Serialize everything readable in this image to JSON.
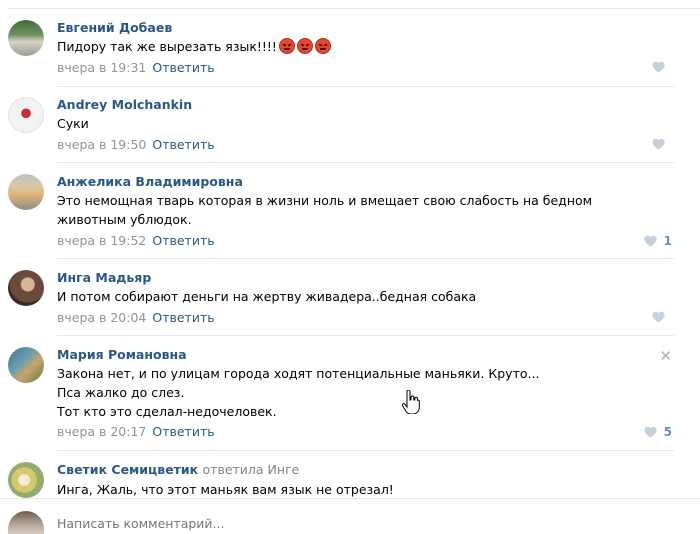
{
  "comments": [
    {
      "author": "Евгений Добаев",
      "text_lines": [
        "Пидору так же вырезать язык!!!!"
      ],
      "emoji_count": 3,
      "time": "вчера в 19:31",
      "reply_label": "Ответить",
      "likes": ""
    },
    {
      "author": "Andrey Molchankin",
      "text_lines": [
        "Суки"
      ],
      "time": "вчера в 19:50",
      "reply_label": "Ответить",
      "likes": ""
    },
    {
      "author": "Анжелика Владимировна",
      "text_lines": [
        "Это немощная тварь которая в жизни ноль и вмещает свою слабость на бедном",
        "животным ублюдок."
      ],
      "time": "вчера в 19:52",
      "reply_label": "Ответить",
      "likes": "1"
    },
    {
      "author": "Инга Мадьяр",
      "text_lines": [
        "И потом собирают деньги на жертву живадера..бедная собака"
      ],
      "time": "вчера в 20:04",
      "reply_label": "Ответить",
      "likes": ""
    },
    {
      "author": "Мария Романовна",
      "text_lines": [
        "Закона нет, и по улицам города ходят потенциальные маньяки. Круто...",
        "Пса жалко до слез.",
        "Тот кто это сделал-недочеловек."
      ],
      "time": "вчера в 20:17",
      "reply_label": "Ответить",
      "likes": "5"
    },
    {
      "author": "Светик Семицветик",
      "reply_to": "ответила Инге",
      "text_lines": [
        "Инга, Жаль, что этот маньяк вам язык не отрезал!"
      ],
      "time": "",
      "reply_label": "",
      "likes": ""
    }
  ],
  "composer": {
    "placeholder": "Написать комментарий..."
  },
  "icons": {
    "like": "heart-icon",
    "close": "close-icon",
    "cursor": "hand-cursor-icon"
  },
  "colors": {
    "link": "#2a5885",
    "meta": "#939393",
    "like": "#c5d0db",
    "separator": "#e7e8ec"
  }
}
